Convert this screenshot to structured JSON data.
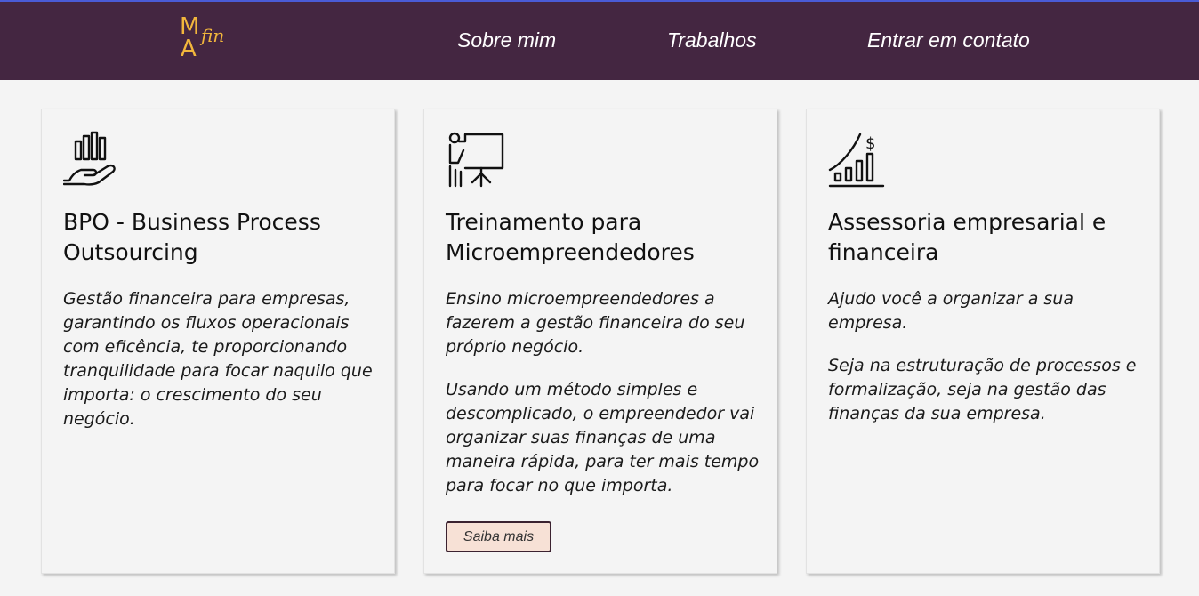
{
  "brand": {
    "logo_m": "M",
    "logo_a": "A",
    "logo_fin": "fin"
  },
  "nav": {
    "about": "Sobre mim",
    "work": "Trabalhos",
    "contact": "Entrar em contato"
  },
  "colors": {
    "header": "#442641",
    "accent": "#f2b63c",
    "button_bg": "#f7e1d6"
  },
  "cards": [
    {
      "icon": "hand-holding-chart-icon",
      "title": "BPO - Business Process Outsourcing",
      "paragraphs": [
        "Gestão financeira para empresas, garantindo os fluxos operacionais com eficência, te proporcionando tranquilidade para focar naquilo que importa: o crescimento do seu negócio."
      ]
    },
    {
      "icon": "presentation-board-icon",
      "title": "Treinamento para Microempreendedores",
      "paragraphs": [
        "Ensino microempreendedores a fazerem a gestão financeira do seu próprio negócio.",
        "Usando um método simples e descomplicado, o empreendedor vai organizar suas finanças de uma maneira rápida, para ter mais tempo para focar no que importa."
      ],
      "button": "Saiba mais"
    },
    {
      "icon": "growth-chart-dollar-icon",
      "title": "Assessoria empresarial e financeira",
      "paragraphs": [
        "Ajudo você a organizar a sua empresa.",
        "Seja na estruturação de processos e formalização, seja na gestão das finanças da sua empresa."
      ]
    }
  ]
}
